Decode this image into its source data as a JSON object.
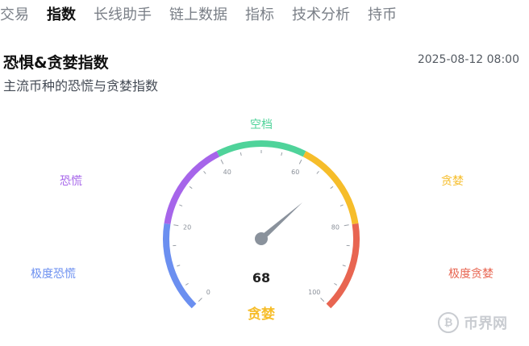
{
  "tabs": [
    {
      "label": "交易",
      "active": false
    },
    {
      "label": "指数",
      "active": true
    },
    {
      "label": "长线助手",
      "active": false
    },
    {
      "label": "链上数据",
      "active": false
    },
    {
      "label": "指标",
      "active": false
    },
    {
      "label": "技术分析",
      "active": false
    },
    {
      "label": "持币",
      "active": false
    }
  ],
  "header": {
    "title": "恐惧&贪婪指数",
    "subtitle": "主流币种的恐慌与贪婪指数",
    "timestamp": "2025-08-12 08:00"
  },
  "gauge": {
    "value": 68,
    "value_text": "68",
    "status_label": "贪婪",
    "min": 0,
    "max": 100,
    "tick_labels": [
      "0",
      "20",
      "40",
      "60",
      "80",
      "100"
    ],
    "zones": [
      {
        "label": "极度恐慌",
        "from": 0,
        "to": 20,
        "color": "#6b8ff0"
      },
      {
        "label": "恐慌",
        "from": 20,
        "to": 40,
        "color": "#a665ea"
      },
      {
        "label": "空档",
        "from": 40,
        "to": 60,
        "color": "#4fd39a"
      },
      {
        "label": "贪婪",
        "from": 60,
        "to": 80,
        "color": "#f6bd2a"
      },
      {
        "label": "极度贪婪",
        "from": 80,
        "to": 100,
        "color": "#e86551"
      }
    ],
    "status_color": "#f6bd2a",
    "needle_color": "#8a929c"
  },
  "watermark": {
    "text": "币界网",
    "icon": "bitcoin-icon"
  }
}
